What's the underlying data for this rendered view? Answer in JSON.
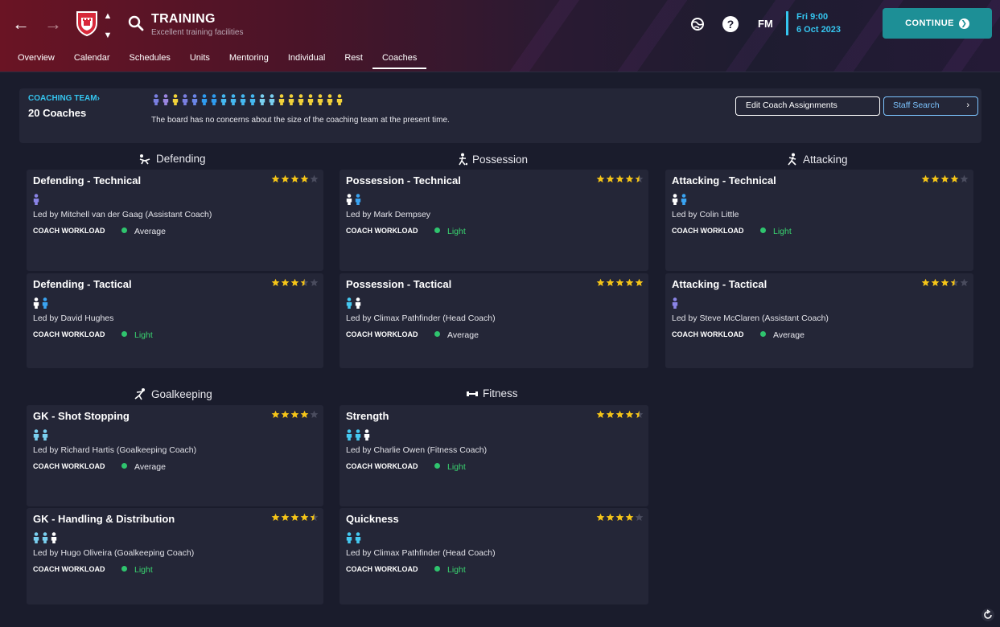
{
  "header": {
    "title": "TRAINING",
    "subtitle": "Excellent training facilities",
    "fm_label": "FM",
    "date_line1": "Fri 9:00",
    "date_line2": "6 Oct 2023",
    "continue_label": "CONTINUE"
  },
  "tabs": [
    "Overview",
    "Calendar",
    "Schedules",
    "Units",
    "Mentoring",
    "Individual",
    "Rest",
    "Coaches"
  ],
  "active_tab": "Coaches",
  "coaching_team": {
    "link_label": "COACHING TEAM",
    "count_label": "20 Coaches",
    "board_message": "The board has no concerns about the size of the coaching team at the present time.",
    "edit_button": "Edit Coach Assignments",
    "staff_search_button": "Staff Search",
    "coach_icon_colors": [
      "#7a7fe0",
      "#9a86e0",
      "#f2d23a",
      "#7a7fe0",
      "#6b86e8",
      "#2f9cf0",
      "#2f9cf0",
      "#45b8f0",
      "#45b8f0",
      "#45b8f0",
      "#45b8f0",
      "#7ad0f0",
      "#7ad0f0",
      "#f2d23a",
      "#f2d23a",
      "#f2d23a",
      "#f2d23a",
      "#f2d23a",
      "#f2d23a",
      "#f2d23a"
    ]
  },
  "colors": {
    "accent": "#35c6f0",
    "continue": "#1d8f96",
    "star": "#f5c518",
    "star_empty": "#4a4c5e",
    "workload_light": "#39d26f",
    "workload_dot": "#2fc46e"
  },
  "categories": {
    "defending": "Defending",
    "possession": "Possession",
    "attacking": "Attacking",
    "goalkeeping": "Goalkeeping",
    "fitness": "Fitness"
  },
  "workload_label": "COACH WORKLOAD",
  "cards": [
    {
      "title": "Defending - Technical",
      "stars": 4,
      "people": [
        "#8a84e6"
      ],
      "led": "Led by Mitchell van der Gaag (Assistant Coach)",
      "workload": "Average"
    },
    {
      "title": "Possession - Technical",
      "stars": 4.5,
      "people": [
        "#ffffff",
        "#3aa4f2"
      ],
      "led": "Led by Mark Dempsey",
      "workload": "Light"
    },
    {
      "title": "Attacking - Technical",
      "stars": 4,
      "people": [
        "#ffffff",
        "#3aa4f2"
      ],
      "led": "Led by Colin Little",
      "workload": "Light"
    },
    {
      "title": "Defending - Tactical",
      "stars": 3.5,
      "people": [
        "#ffffff",
        "#3aa4f2"
      ],
      "led": "Led by David Hughes",
      "workload": "Light"
    },
    {
      "title": "Possession - Tactical",
      "stars": 5,
      "people": [
        "#45c8f0",
        "#ffffff"
      ],
      "led": "Led by Climax Pathfinder (Head Coach)",
      "workload": "Average"
    },
    {
      "title": "Attacking - Tactical",
      "stars": 3.5,
      "people": [
        "#8a84e6"
      ],
      "led": "Led by Steve McClaren (Assistant Coach)",
      "workload": "Average"
    },
    {
      "title": "GK - Shot Stopping",
      "stars": 4,
      "people": [
        "#7ad0f0",
        "#7ad0f0"
      ],
      "led": "Led by Richard Hartis (Goalkeeping Coach)",
      "workload": "Average"
    },
    {
      "title": "Strength",
      "stars": 4.5,
      "people": [
        "#45c8f0",
        "#45c8f0",
        "#ffffff"
      ],
      "led": "Led by Charlie Owen (Fitness Coach)",
      "workload": "Light"
    },
    {
      "title": "GK - Handling & Distribution",
      "stars": 4.5,
      "people": [
        "#7ad0f0",
        "#7ad0f0",
        "#ffffff"
      ],
      "led": "Led by Hugo Oliveira (Goalkeeping Coach)",
      "workload": "Light"
    },
    {
      "title": "Quickness",
      "stars": 4,
      "people": [
        "#45c8f0",
        "#45c8f0"
      ],
      "led": "Led by Climax Pathfinder (Head Coach)",
      "workload": "Light"
    }
  ]
}
